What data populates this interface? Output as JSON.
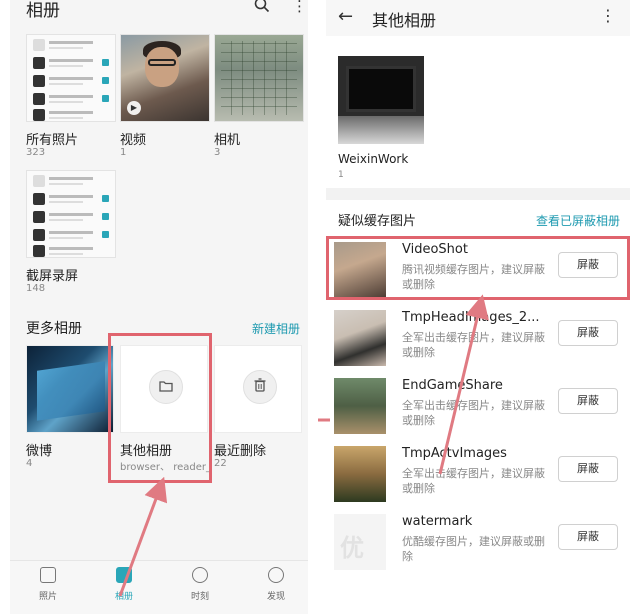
{
  "left": {
    "header": {
      "title": "相册",
      "search_icon": "search-icon",
      "menu_icon": "more-vert-icon"
    },
    "albums": [
      {
        "label": "所有照片",
        "count": "323"
      },
      {
        "label": "视频",
        "count": "1"
      },
      {
        "label": "相机",
        "count": "3"
      },
      {
        "label": "截屏录屏",
        "count": "148"
      }
    ],
    "more_section": {
      "title": "更多相册",
      "link": "新建相册"
    },
    "more_albums": [
      {
        "label": "微博",
        "count": "4"
      },
      {
        "label": "其他相册",
        "sub": "browser、 reader_..."
      },
      {
        "label": "最近删除",
        "count": "22"
      }
    ],
    "nav": [
      {
        "label": "照片",
        "active": false
      },
      {
        "label": "相册",
        "active": true
      },
      {
        "label": "时刻",
        "active": false
      },
      {
        "label": "发现",
        "active": false
      }
    ]
  },
  "right": {
    "header": {
      "title": "其他相册",
      "back_icon": "arrow-back-icon",
      "menu_icon": "more-vert-icon"
    },
    "album": {
      "label": "WeixinWork",
      "count": "1"
    },
    "cache_section": {
      "title": "疑似缓存图片",
      "link": "查看已屏蔽相册"
    },
    "block_label": "屏蔽",
    "items": [
      {
        "name": "VideoShot",
        "desc": "腾讯视频缓存图片，建议屏蔽或删除"
      },
      {
        "name": "TmpHeadImages_2...",
        "desc": "全军出击缓存图片，建议屏蔽或删除"
      },
      {
        "name": "EndGameShare",
        "desc": "全军出击缓存图片，建议屏蔽或删除"
      },
      {
        "name": "TmpActvImages",
        "desc": "全军出击缓存图片，建议屏蔽或删除"
      },
      {
        "name": "watermark",
        "desc": "优酷缓存图片，建议屏蔽或删除"
      }
    ]
  },
  "colors": {
    "accent": "#1e9ab0",
    "highlight": "#e0646e"
  }
}
